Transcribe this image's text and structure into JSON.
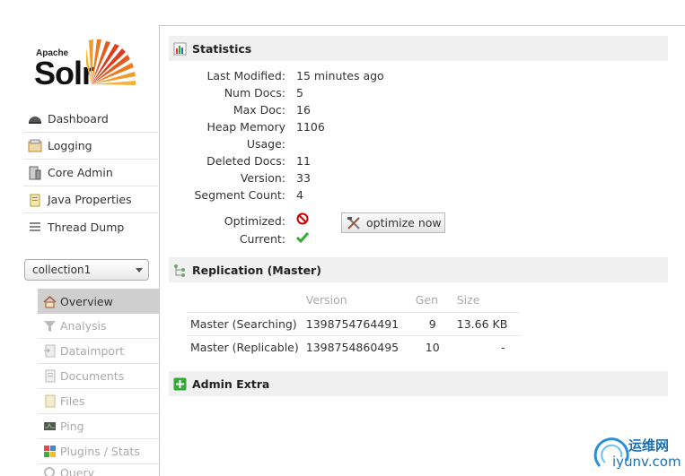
{
  "logo": {
    "apache": "Apache",
    "solr": "Solr"
  },
  "nav": [
    {
      "label": "Dashboard",
      "icon": "dashboard-icon"
    },
    {
      "label": "Logging",
      "icon": "logging-icon"
    },
    {
      "label": "Core Admin",
      "icon": "core-admin-icon"
    },
    {
      "label": "Java Properties",
      "icon": "java-properties-icon"
    },
    {
      "label": "Thread Dump",
      "icon": "thread-dump-icon"
    }
  ],
  "core_selector": {
    "value": "collection1"
  },
  "core_menu": [
    {
      "label": "Overview",
      "active": true
    },
    {
      "label": "Analysis"
    },
    {
      "label": "Dataimport"
    },
    {
      "label": "Documents"
    },
    {
      "label": "Files"
    },
    {
      "label": "Ping"
    },
    {
      "label": "Plugins / Stats"
    },
    {
      "label": "Query"
    }
  ],
  "statistics": {
    "title": "Statistics",
    "rows": [
      {
        "label": "Last Modified:",
        "value": "15 minutes ago"
      },
      {
        "label": "Num Docs:",
        "value": "5"
      },
      {
        "label": "Max Doc:",
        "value": "16"
      },
      {
        "label": "Heap Memory",
        "value": "1106"
      },
      {
        "label": "Usage:",
        "value": ""
      },
      {
        "label": "Deleted Docs:",
        "value": "11"
      },
      {
        "label": "Version:",
        "value": "33"
      },
      {
        "label": "Segment Count:",
        "value": "4"
      }
    ],
    "optimized_label": "Optimized:",
    "current_label": "Current:",
    "optimize_button": "optimize now"
  },
  "replication": {
    "title": "Replication (Master)",
    "headers": [
      "",
      "Version",
      "Gen",
      "Size"
    ],
    "rows": [
      [
        "Master (Searching)",
        "1398754764491",
        "9",
        "13.66 KB"
      ],
      [
        "Master (Replicable)",
        "1398754860495",
        "10",
        "-"
      ]
    ]
  },
  "admin_extra": {
    "title": "Admin Extra"
  },
  "watermark": {
    "cn": "运维网",
    "url": "iyunv.com"
  }
}
